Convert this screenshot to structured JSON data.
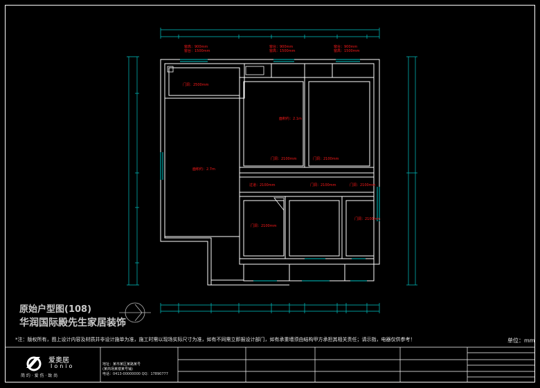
{
  "drawing": {
    "title_line1": "原始户型图(108)",
    "title_line2": "华润国际殿先生家居装饰",
    "note": "*注：版权所有，图上设计内容及材质并非设计施单为准，施工时需以现场实际尺寸为准，如有不同需立即报设计部门，如有承重墙须由结构甲方承担其相关责任；请示指，电器仅供参考！",
    "unit_label": "单位：mm"
  },
  "rooms": [
    {
      "id": "living",
      "label": "面积约：2.7m"
    },
    {
      "id": "bedroom1",
      "label": "面积约：2.1m"
    },
    {
      "id": "kitchen-door",
      "label": "门洞：2500mm"
    },
    {
      "id": "corridor",
      "label": "过道：2100mm"
    },
    {
      "id": "door-left",
      "label": "门洞：2100mm"
    },
    {
      "id": "door-right",
      "label": "门洞：2100mm"
    },
    {
      "id": "door-mid1",
      "label": "门洞：2100mm"
    },
    {
      "id": "door-mid2",
      "label": "门洞：2100mm"
    },
    {
      "id": "door-bath",
      "label": "门洞：2100mm"
    },
    {
      "id": "room-small",
      "label": "门洞：2100mm"
    }
  ],
  "top_labels": [
    {
      "id": "t1a",
      "label": "窗高：900mm"
    },
    {
      "id": "t1b",
      "label": "窗台：1500mm"
    },
    {
      "id": "t2a",
      "label": "窗台：900mm"
    },
    {
      "id": "t2b",
      "label": "窗高：1500mm"
    },
    {
      "id": "t3a",
      "label": "窗台：900mm"
    },
    {
      "id": "t3b",
      "label": "窗高：1500mm"
    }
  ],
  "company": {
    "name": "爱奥居",
    "name_en": "Ionio",
    "slogan": "简 约 · 爱 伤 · 致 尚",
    "addr1": "地址：某市某区某路某号",
    "addr2": "(某商场某楼某号铺)",
    "addr3": "电话：0413-00000000  QQ：17890777"
  },
  "colors": {
    "wall": "#ffffff",
    "dimension": "#00c8c8",
    "annotation": "#ff1a1a",
    "background": "#000000"
  }
}
